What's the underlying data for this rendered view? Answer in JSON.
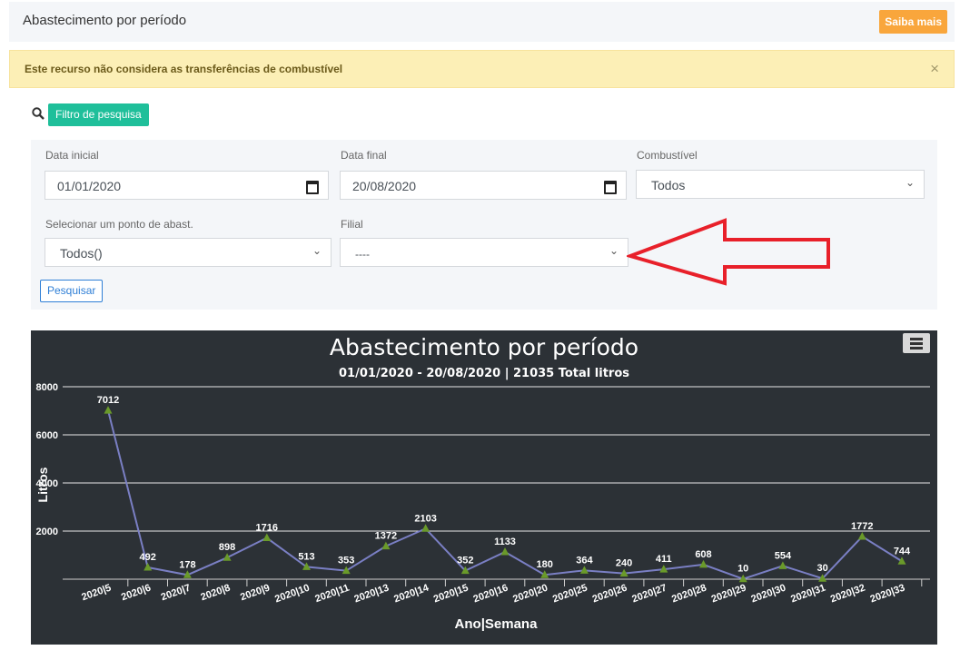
{
  "header": {
    "title": "Abastecimento por período",
    "saiba_label": "Saiba mais"
  },
  "alert": {
    "message": "Este recurso não considera as transferências de combustível",
    "close": "×"
  },
  "filter": {
    "button_label": "Filtro de pesquisa"
  },
  "form": {
    "data_inicial_label": "Data inicial",
    "data_inicial_value": "01/01/2020",
    "data_final_label": "Data final",
    "data_final_value": "20/08/2020",
    "combustivel_label": "Combustível",
    "combustivel_value": "Todos",
    "ponto_label": "Selecionar um ponto de abast.",
    "ponto_value": "Todos()",
    "filial_label": "Filial",
    "filial_value": "----",
    "search_button": "Pesquisar"
  },
  "colors": {
    "accent_green": "#1fbf9a",
    "orange": "#f9a63c",
    "annotation_arrow": "#e8202a",
    "line": "#7a7fc4",
    "marker": "#6a9a2a"
  },
  "chart_data": {
    "type": "line",
    "title": "Abastecimento por período",
    "subtitle": "01/01/2020 - 20/08/2020 | 21035 Total litros",
    "xlabel": "Ano|Semana",
    "ylabel": "Litros",
    "ylim": [
      0,
      8000
    ],
    "yticks": [
      2000,
      4000,
      6000,
      8000
    ],
    "grid": true,
    "categories": [
      "2020|5",
      "2020|6",
      "2020|7",
      "2020|8",
      "2020|9",
      "2020|10",
      "2020|11",
      "2020|13",
      "2020|14",
      "2020|15",
      "2020|16",
      "2020|20",
      "2020|25",
      "2020|26",
      "2020|27",
      "2020|28",
      "2020|29",
      "2020|30",
      "2020|31",
      "2020|32",
      "2020|33"
    ],
    "values": [
      7012,
      492,
      178,
      898,
      1716,
      513,
      353,
      1372,
      2103,
      352,
      1133,
      180,
      364,
      240,
      411,
      608,
      10,
      554,
      30,
      1772,
      744
    ]
  }
}
